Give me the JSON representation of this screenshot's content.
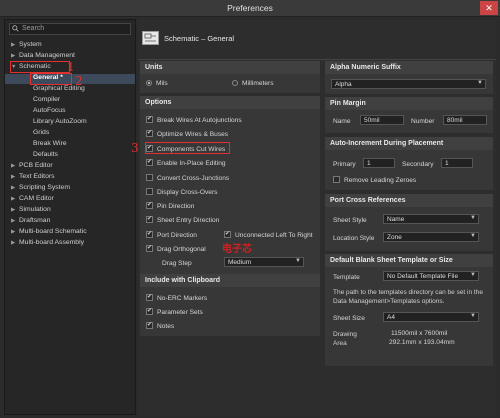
{
  "window": {
    "title": "Preferences",
    "close_glyph": "✕"
  },
  "search": {
    "placeholder": "Search"
  },
  "tree": {
    "items": [
      {
        "label": "System",
        "arrow": "▶"
      },
      {
        "label": "Data Management",
        "arrow": "▶"
      },
      {
        "label": "Schematic",
        "arrow": "▼"
      },
      {
        "label": "General *",
        "arrow": ""
      },
      {
        "label": "Graphical Editing",
        "arrow": ""
      },
      {
        "label": "Compiler",
        "arrow": ""
      },
      {
        "label": "AutoFocus",
        "arrow": ""
      },
      {
        "label": "Library AutoZoom",
        "arrow": ""
      },
      {
        "label": "Grids",
        "arrow": ""
      },
      {
        "label": "Break Wire",
        "arrow": ""
      },
      {
        "label": "Defaults",
        "arrow": ""
      },
      {
        "label": "PCB Editor",
        "arrow": "▶"
      },
      {
        "label": "Text Editors",
        "arrow": "▶"
      },
      {
        "label": "Scripting System",
        "arrow": "▶"
      },
      {
        "label": "CAM Editor",
        "arrow": "▶"
      },
      {
        "label": "Simulation",
        "arrow": "▶"
      },
      {
        "label": "Draftsman",
        "arrow": "▶"
      },
      {
        "label": "Multi-board Schematic",
        "arrow": "▶"
      },
      {
        "label": "Multi-board Assembly",
        "arrow": "▶"
      }
    ]
  },
  "annotations": {
    "num1": "1",
    "num2": "2",
    "num3": "3",
    "watermark": "电子芯"
  },
  "header": {
    "title": "Schematic – General"
  },
  "units": {
    "heading": "Units",
    "mils": "Mils",
    "millimeters": "Millimeters"
  },
  "options": {
    "heading": "Options",
    "items": [
      "Break Wires At Autojunctions",
      "Optimize Wires & Buses",
      "Components Cut Wires",
      "Enable In-Place Editing",
      "Convert Cross-Junctions",
      "Display Cross-Overs",
      "Pin Direction",
      "Sheet Entry Direction",
      "Port Direction",
      "Drag Orthogonal"
    ],
    "unconnected": "Unconnected Left To Right",
    "drag_step_label": "Drag Step",
    "drag_step_value": "Medium"
  },
  "clipboard": {
    "heading": "Include with Clipboard",
    "items": [
      "No-ERC Markers",
      "Parameter Sets",
      "Notes"
    ]
  },
  "alpha": {
    "heading": "Alpha Numeric Suffix",
    "value": "Alpha"
  },
  "pin_margin": {
    "heading": "Pin Margin",
    "name_label": "Name",
    "name_value": "50mil",
    "number_label": "Number",
    "number_value": "80mil"
  },
  "auto_inc": {
    "heading": "Auto-Increment During Placement",
    "primary_label": "Primary",
    "primary_value": "1",
    "secondary_label": "Secondary",
    "secondary_value": "1",
    "remove_zeros": "Remove Leading Zeroes"
  },
  "port_cross": {
    "heading": "Port Cross References",
    "sheet_style_label": "Sheet Style",
    "sheet_style_value": "Name",
    "location_style_label": "Location Style",
    "location_style_value": "Zone"
  },
  "template": {
    "heading": "Default Blank Sheet Template or Size",
    "template_label": "Template",
    "template_value": "No Default Template File",
    "desc": "The path to the templates directory can be set in the Data Management>Templates options.",
    "sheet_size_label": "Sheet Size",
    "sheet_size_value": "A4",
    "drawing_area_label": "Drawing Area",
    "area_mil": "11500mil x 7600mil",
    "area_mm": "292.1mm x 193.04mm"
  }
}
